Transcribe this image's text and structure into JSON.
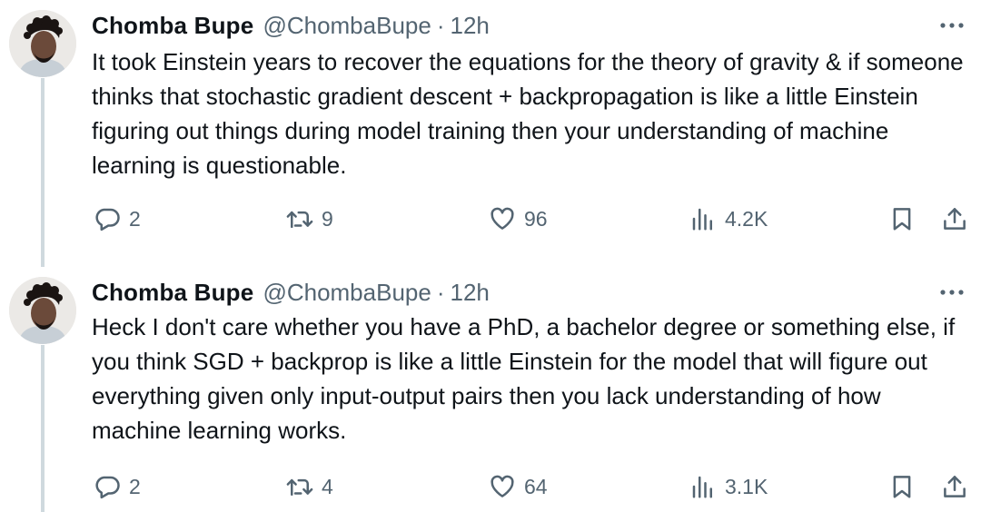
{
  "tweets": [
    {
      "author_name": "Chomba Bupe",
      "handle": "@ChombaBupe",
      "separator": "·",
      "time": "12h",
      "text": "It took Einstein years to recover the equations for the theory of gravity & if someone thinks that stochastic gradient descent + backpropagation is like a little Einstein figuring out things during model training then your understanding of machine learning is questionable.",
      "replies": "2",
      "retweets": "9",
      "likes": "96",
      "views": "4.2K"
    },
    {
      "author_name": "Chomba Bupe",
      "handle": "@ChombaBupe",
      "separator": "·",
      "time": "12h",
      "text": "Heck I don't care whether you have a PhD, a bachelor degree or something else, if you think SGD + backprop is like a little Einstein for the model that will figure out everything given only input-output pairs then you lack understanding of how machine learning works.",
      "replies": "2",
      "retweets": "4",
      "likes": "64",
      "views": "3.1K"
    }
  ],
  "icons": {
    "more": "more-horizontal-icon",
    "reply": "reply-bubble-icon",
    "retweet": "retweet-icon",
    "like": "heart-icon",
    "views": "views-bar-chart-icon",
    "bookmark": "bookmark-icon",
    "share": "share-upload-icon"
  },
  "colors": {
    "text": "#0f1419",
    "secondary": "#536471",
    "thread_line": "#cfd9de"
  }
}
